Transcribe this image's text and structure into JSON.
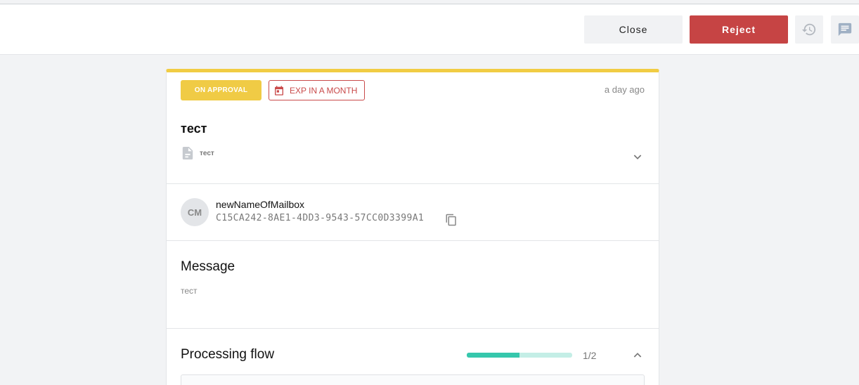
{
  "toolbar": {
    "close_label": "Close",
    "reject_label": "Reject",
    "history_icon": "history-icon",
    "chat_icon": "chat-icon"
  },
  "request": {
    "status_badge": "ON APPROVAL",
    "expiry_badge": "EXP IN A MONTH",
    "time_ago": "a day ago",
    "title": "тест",
    "document_label": "тест"
  },
  "sender": {
    "initials": "CM",
    "name": "newNameOfMailbox",
    "id": "C15CA242-8AE1-4DD3-9543-57CC0D3399A1"
  },
  "message": {
    "heading": "Message",
    "body": "тест"
  },
  "flow": {
    "heading": "Processing flow",
    "progress_fraction": 0.5,
    "count": "1/2"
  },
  "colors": {
    "accent_yellow": "#f1cc43",
    "reject_red": "#c64444",
    "progress_teal": "#36c7ac"
  }
}
